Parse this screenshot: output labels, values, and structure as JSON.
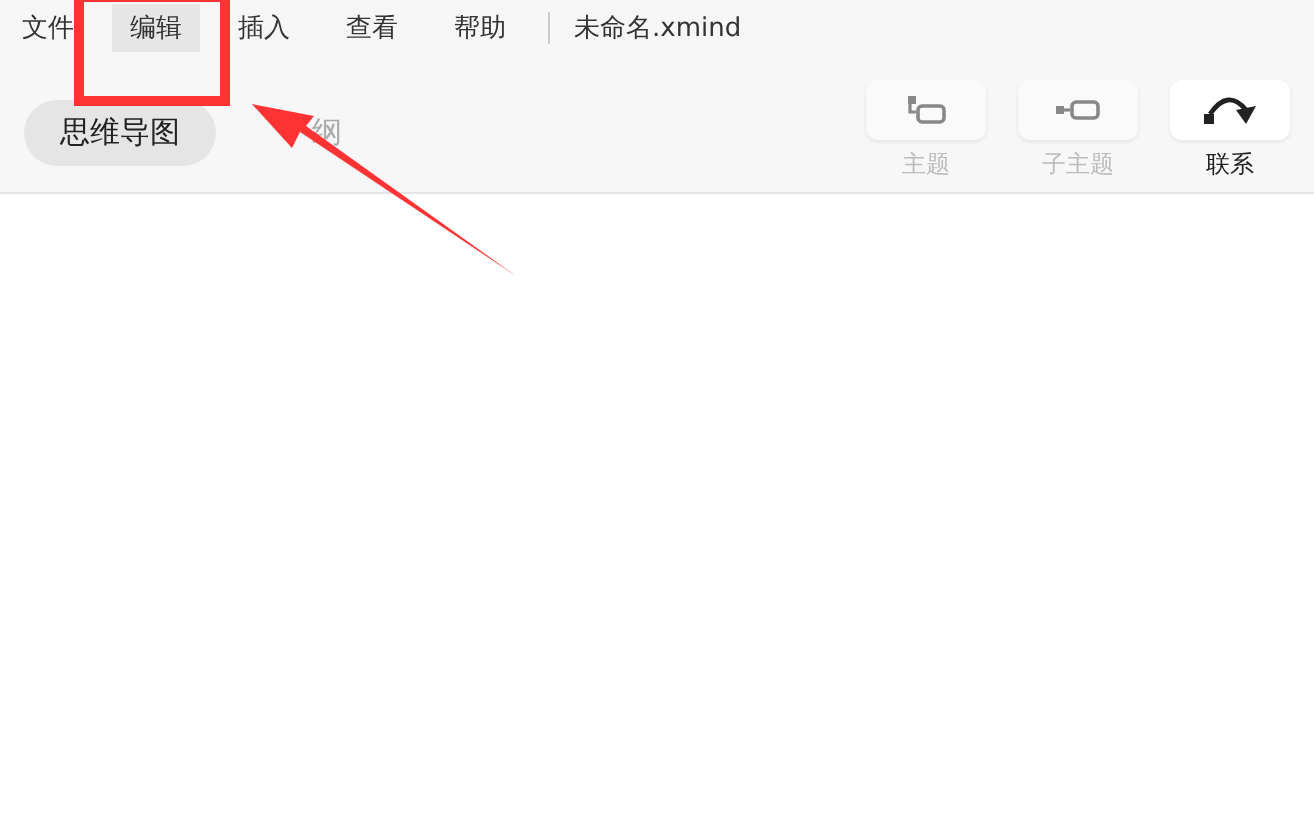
{
  "menu_bar": {
    "items": [
      {
        "label": "文件",
        "selected": false
      },
      {
        "label": "编辑",
        "selected": true
      },
      {
        "label": "插入",
        "selected": false
      },
      {
        "label": "查看",
        "selected": false
      },
      {
        "label": "帮助",
        "selected": false
      }
    ],
    "document_title": "未命名.xmind"
  },
  "view_tabs": [
    {
      "label": "思维导图",
      "selected": true
    },
    {
      "label": "纲",
      "selected": false
    }
  ],
  "tools": [
    {
      "kind": "topic",
      "label": "主题",
      "disabled": true
    },
    {
      "kind": "subtopic",
      "label": "子主题",
      "disabled": true
    },
    {
      "kind": "relationship",
      "label": "联系",
      "disabled": false
    }
  ]
}
